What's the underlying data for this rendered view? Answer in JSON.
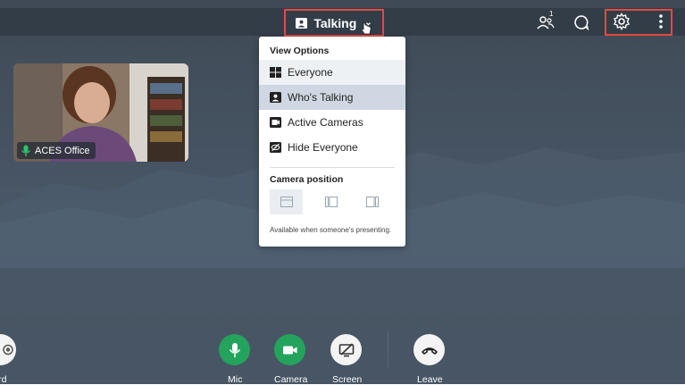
{
  "topbar": {
    "layout_button": {
      "label": "Talking",
      "icon": "speaker-view-icon",
      "chevron": "chevron-down-icon"
    },
    "participants": {
      "icon": "participants-icon",
      "count": "1"
    },
    "chat": {
      "icon": "chat-icon"
    },
    "settings": {
      "icon": "gear-icon"
    },
    "more": {
      "icon": "kebab-menu-icon"
    },
    "highlight_color": "#e24a43"
  },
  "video": {
    "participant_name": "ACES Office",
    "mic_icon": "mic-icon"
  },
  "view_menu": {
    "title": "View Options",
    "items": [
      {
        "label": "Everyone",
        "icon": "grid-icon",
        "state": "hover"
      },
      {
        "label": "Who's Talking",
        "icon": "speaker-view-icon",
        "state": "selected"
      },
      {
        "label": "Active Cameras",
        "icon": "camera-box-icon",
        "state": ""
      },
      {
        "label": "Hide Everyone",
        "icon": "eye-off-icon",
        "state": ""
      }
    ],
    "camera_position": {
      "title": "Camera position",
      "options": [
        "top-strip-icon",
        "left-strip-icon",
        "right-strip-icon"
      ],
      "note": "Available when someone's presenting."
    }
  },
  "controls": [
    {
      "label": "cord",
      "icon": "record-icon"
    },
    {
      "label": "Mic",
      "icon": "mic-icon"
    },
    {
      "label": "Camera",
      "icon": "video-camera-icon"
    },
    {
      "label": "Screen",
      "icon": "screen-share-off-icon"
    },
    {
      "label": "Leave",
      "icon": "hang-up-icon"
    }
  ],
  "colors": {
    "accent_green": "#24a35c",
    "menu_selected": "#cfd8e2",
    "topbar": "#333d48"
  }
}
